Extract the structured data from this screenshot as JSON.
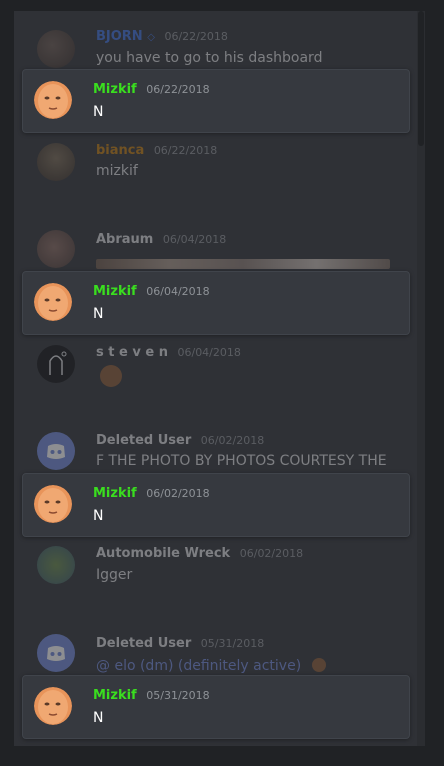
{
  "colors": {
    "background": "#202225",
    "panel": "#2f3136",
    "highlight_card": "#36393f",
    "mizkif_name": "#3ade1f",
    "bjorn_name": "#3e70dd",
    "bianca_name": "#c27c0e",
    "default_name": "#dcddde",
    "timestamp": "#8e9297"
  },
  "messages": [
    {
      "author": "BJORN",
      "badge_icon": "diamond-icon",
      "date": "06/22/2018",
      "text": "you have to go to his dashboard",
      "highlighted": false
    },
    {
      "author": "Mizkif",
      "date": "06/22/2018",
      "text": "N",
      "highlighted": true
    },
    {
      "author": "bianca",
      "date": "06/22/2018",
      "text": "mizkif",
      "highlighted": false
    },
    {
      "author": "Abraum",
      "date": "06/04/2018",
      "text": "",
      "attachment": "image-attachment",
      "highlighted": false
    },
    {
      "author": "Mizkif",
      "date": "06/04/2018",
      "text": "N",
      "highlighted": true
    },
    {
      "author": "s t e v e n",
      "date": "06/04/2018",
      "text": "",
      "attachment": "emoji-sticker",
      "highlighted": false
    },
    {
      "author": "Deleted User",
      "date": "06/02/2018",
      "text": "F THE PHOTO BY PHOTOS COURTESY THE",
      "highlighted": false
    },
    {
      "author": "Mizkif",
      "date": "06/02/2018",
      "text": "N",
      "highlighted": true
    },
    {
      "author": "Automobile Wreck",
      "date": "06/02/2018",
      "text": "Igger",
      "highlighted": false
    },
    {
      "author": "Deleted User",
      "date": "05/31/2018",
      "text": "@ elo (dm) (definitely active)",
      "highlighted": false
    },
    {
      "author": "Mizkif",
      "date": "05/31/2018",
      "text": "N",
      "highlighted": true
    }
  ]
}
